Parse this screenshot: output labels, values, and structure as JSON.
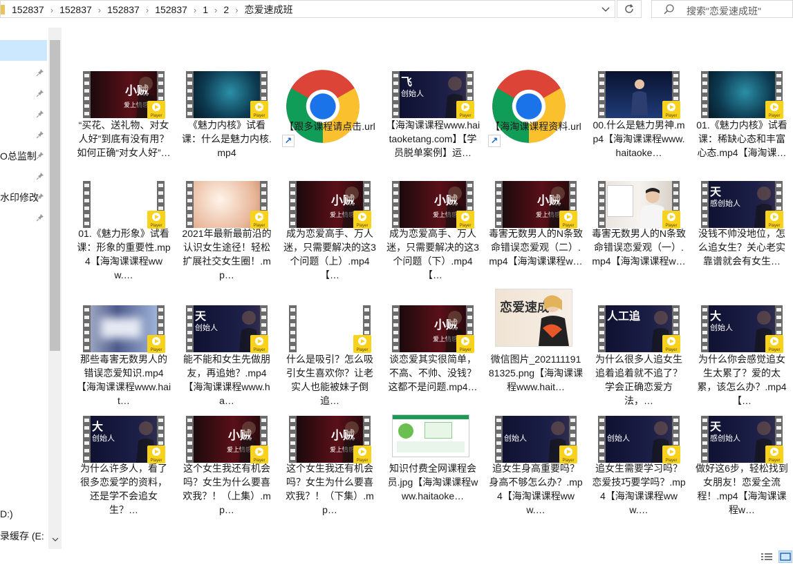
{
  "address_bar": {
    "crumbs": [
      "152837",
      "152837",
      "152837",
      "152837",
      "1",
      "2",
      "恋爱速成班"
    ],
    "dropdown_icon": "chevron-down-icon",
    "refresh_icon": "refresh-icon"
  },
  "search": {
    "placeholder": "搜索\"恋爱速成班\""
  },
  "nav": {
    "labels": [
      "O总监制",
      "水印修改",
      "D:)",
      "录缓存 (E:"
    ]
  },
  "files": [
    {
      "name": "“买花、送礼物、对女人好”到底有没有用？如何正确“对女人好”…",
      "type": "video",
      "thumb": "dark",
      "t1": "小贼",
      "t2": "爱上情感创"
    },
    {
      "name": "《魅力内核》试看课：什么是魅力内核.mp4",
      "type": "video",
      "thumb": "teal"
    },
    {
      "name": "【跟多课程请点击.url",
      "type": "url"
    },
    {
      "name": "【海淘课课程www.haitaoketang.com】【学员脱单案例】运…",
      "type": "video",
      "thumb": "navy",
      "tl": "飞",
      "tl2": "创始人"
    },
    {
      "name": "【海淘课课程资料.url",
      "type": "url"
    },
    {
      "name": "00.什么是魅力男神.mp4【海淘课课程www.haitaoke…",
      "type": "video",
      "thumb": "stage"
    },
    {
      "name": "01.《魅力内核》试看课：稀缺心态和丰富心态.mp4【海淘课…",
      "type": "video",
      "thumb": "teal"
    },
    {
      "name": "01.《魅力形象》试看课：形象的重要性.mp4【海淘课课程www.…",
      "type": "video",
      "thumb": "white"
    },
    {
      "name": "2021年最新最前沿的认识女生途径！轻松扩展社交女生圈！.mp…",
      "type": "video",
      "thumb": "peach"
    },
    {
      "name": "成为恋爱高手、万人迷，只需要解决的这3个问题（上）.mp4【…",
      "type": "video",
      "thumb": "dark",
      "t1": "小贼",
      "t2": "爱上情感创"
    },
    {
      "name": "成为恋爱高手、万人迷，只需要解决的这3个问题（下）.mp4【…",
      "type": "video",
      "thumb": "dark",
      "t1": "小贼",
      "t2": "爱上情感创"
    },
    {
      "name": "毒害无数男人的N条致命错误恋爱观（二）.mp4【海淘课课程w…",
      "type": "video",
      "thumb": "dark",
      "t1": "小贼",
      "t2": "爱上情感创"
    },
    {
      "name": "毒害无数男人的N条致命错误恋爱观（一）.mp4【海淘课课程w…",
      "type": "video",
      "thumb": "room"
    },
    {
      "name": "没钱不帅没地位，怎么追女生？关心老实靠谱就会有女生…",
      "type": "video",
      "thumb": "navy",
      "tl": "天",
      "tl2": "感创始人"
    },
    {
      "name": "那些毒害无数男人的错误恋爱知识.mp4【海淘课课程www.hait…",
      "type": "video",
      "thumb": "blur"
    },
    {
      "name": "能不能和女生先做朋友，再追她？.mp4【海淘课课程www.ha…",
      "type": "video",
      "thumb": "navy",
      "tl": "天",
      "tl2": "创始人"
    },
    {
      "name": "什么是吸引？怎么吸引女生喜欢你？让老实人也能被妹子倒追…",
      "type": "video",
      "thumb": "white"
    },
    {
      "name": "谈恋爱其实很简单，不高、不帅、没钱？这都不是问题.mp4…",
      "type": "video",
      "thumb": "dark",
      "t1": "小贼",
      "t2": "爱上情感创"
    },
    {
      "name": "微信图片_20211119181325.png【海淘课课程www.hait…",
      "type": "image",
      "thumb": "poster",
      "caption": "恋爱速成"
    },
    {
      "name": "为什么很多人追女生追着追着就不追了？学会正确恋爱方法，…",
      "type": "video",
      "thumb": "navy",
      "tl": "人工追",
      "tl2": ""
    },
    {
      "name": "为什么你会感觉追女生太累了？爱的太累，该怎么办？.mp4【…",
      "type": "video",
      "thumb": "navy",
      "tl": "大",
      "tl2": "创始人"
    },
    {
      "name": "为什么许多人，看了很多恋爱学的资料，还是学不会追女生？…",
      "type": "video",
      "thumb": "navy",
      "tl": "大",
      "tl2": "创始人"
    },
    {
      "name": "这个女生我还有机会吗？女生为什么要喜欢我？！（上集）.mp…",
      "type": "video",
      "thumb": "dark",
      "t1": "小贼",
      "t2": "爱上情感创"
    },
    {
      "name": "这个女生我还有机会吗？女生为什么要喜欢我？！（下集）.mp…",
      "type": "video",
      "thumb": "dark",
      "t1": "小贼",
      "t2": "爱上情感创"
    },
    {
      "name": "知识付费全网课程会员.jpg【海淘课课程www.haitaoke…",
      "type": "image",
      "thumb": "green"
    },
    {
      "name": "追女生身高重要吗？身高不够怎么办？.mp4【海淘课课程www.…",
      "type": "video",
      "thumb": "navy",
      "tl": "",
      "tl2": "创始人"
    },
    {
      "name": "追女生需要学习吗？恋爱技巧要学吗？.mp4【海淘课课程www.…",
      "type": "video",
      "thumb": "navy",
      "tl": "",
      "tl2": "创始人"
    },
    {
      "name": "做好这6步，轻松找到女朋友！恋爱全流程！.mp4【海淘课课程w…",
      "type": "video",
      "thumb": "navy",
      "tl": "天",
      "tl2": "感创始人"
    }
  ],
  "badge_text": "Player",
  "colors": {
    "selection": "#cce8ff",
    "badge": "#f8d21c"
  }
}
